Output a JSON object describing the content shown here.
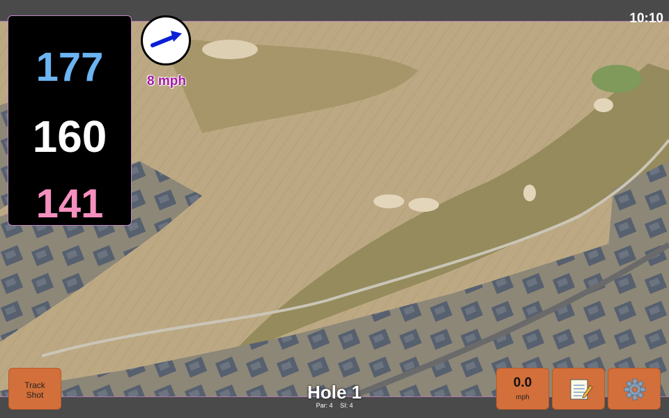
{
  "status": {
    "time": "10:10"
  },
  "distances": {
    "back": "177",
    "middle": "160",
    "front": "141"
  },
  "wind": {
    "speed_label": "8 mph",
    "direction_icon": "wind-arrow-icon",
    "arrow_color": "#0a1fd6"
  },
  "hole": {
    "title": "Hole 1",
    "par": "Par: 4",
    "stroke_index": "SI: 4"
  },
  "buttons": {
    "track_shot_line1": "Track",
    "track_shot_line2": "Shot",
    "wind_value": "0.0",
    "wind_unit": "mph",
    "notes_icon": "notepad-icon",
    "settings_icon": "gear-icon"
  },
  "colors": {
    "back_distance": "#6cb4f2",
    "middle_distance": "#ffffff",
    "front_distance": "#f58fbe",
    "button_accent": "#d36f3a",
    "wind_text": "#a61aa6"
  }
}
